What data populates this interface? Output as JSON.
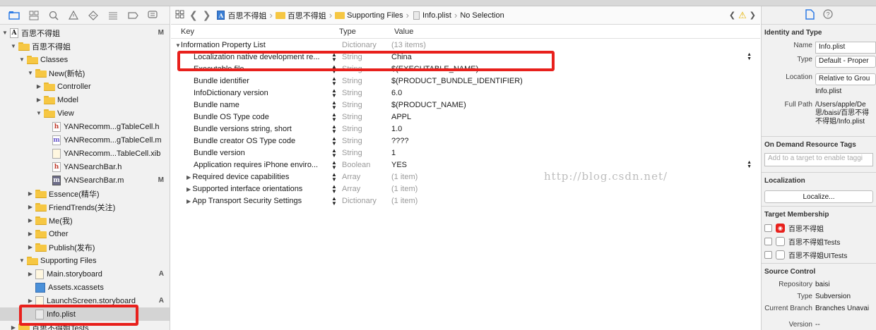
{
  "navigator": {
    "tree": [
      {
        "label": "百思不得姐",
        "kind": "project",
        "level": 0,
        "disclosure": "open",
        "badge": "M"
      },
      {
        "label": "百思不得姐",
        "kind": "folder",
        "level": 1,
        "disclosure": "open",
        "badge": ""
      },
      {
        "label": "Classes",
        "kind": "folder",
        "level": 2,
        "disclosure": "open",
        "badge": ""
      },
      {
        "label": "New(新帖)",
        "kind": "folder",
        "level": 3,
        "disclosure": "open",
        "badge": ""
      },
      {
        "label": "Controller",
        "kind": "folder",
        "level": 4,
        "disclosure": "closed",
        "badge": ""
      },
      {
        "label": "Model",
        "kind": "folder",
        "level": 4,
        "disclosure": "closed",
        "badge": ""
      },
      {
        "label": "View",
        "kind": "folder",
        "level": 4,
        "disclosure": "open",
        "badge": ""
      },
      {
        "label": "YANRecomm...gTableCell.h",
        "kind": "h",
        "level": 5,
        "disclosure": "none",
        "badge": ""
      },
      {
        "label": "YANRecomm...gTableCell.m",
        "kind": "m",
        "level": 5,
        "disclosure": "none",
        "badge": ""
      },
      {
        "label": "YANRecomm...TableCell.xib",
        "kind": "xib",
        "level": 5,
        "disclosure": "none",
        "badge": ""
      },
      {
        "label": "YANSearchBar.h",
        "kind": "h",
        "level": 5,
        "disclosure": "none",
        "badge": ""
      },
      {
        "label": "YANSearchBar.m",
        "kind": "mdark",
        "level": 5,
        "disclosure": "none",
        "badge": "M"
      },
      {
        "label": "Essence(精华)",
        "kind": "folder",
        "level": 3,
        "disclosure": "closed",
        "badge": ""
      },
      {
        "label": "FriendTrends(关注)",
        "kind": "folder",
        "level": 3,
        "disclosure": "closed",
        "badge": ""
      },
      {
        "label": "Me(我)",
        "kind": "folder",
        "level": 3,
        "disclosure": "closed",
        "badge": ""
      },
      {
        "label": "Other",
        "kind": "folder",
        "level": 3,
        "disclosure": "closed",
        "badge": ""
      },
      {
        "label": "Publish(发布)",
        "kind": "folder",
        "level": 3,
        "disclosure": "closed",
        "badge": ""
      },
      {
        "label": "Supporting Files",
        "kind": "folder",
        "level": 2,
        "disclosure": "open",
        "badge": ""
      },
      {
        "label": "Main.storyboard",
        "kind": "xib",
        "level": 3,
        "disclosure": "closed",
        "badge": "A"
      },
      {
        "label": "Assets.xcassets",
        "kind": "assets",
        "level": 3,
        "disclosure": "none",
        "badge": ""
      },
      {
        "label": "LaunchScreen.storyboard",
        "kind": "xib",
        "level": 3,
        "disclosure": "closed",
        "badge": "A"
      },
      {
        "label": "Info.plist",
        "kind": "plist",
        "level": 3,
        "disclosure": "none",
        "badge": "",
        "selected": true
      },
      {
        "label": "百思不得姐Tests",
        "kind": "folder",
        "level": 1,
        "disclosure": "closed",
        "badge": ""
      }
    ]
  },
  "jumpbar": {
    "crumbs": [
      "百思不得姐",
      "百思不得姐",
      "Supporting Files",
      "Info.plist",
      "No Selection"
    ]
  },
  "plist": {
    "headers": {
      "key": "Key",
      "type": "Type",
      "value": "Value"
    },
    "root": {
      "key": "Information Property List",
      "type": "Dictionary",
      "value": "(13 items)"
    },
    "rows": [
      {
        "key": "Localization native development re...",
        "type": "String",
        "value": "China",
        "dropdown": true
      },
      {
        "key": "Executable file",
        "type": "String",
        "value": "$(EXECUTABLE_NAME)"
      },
      {
        "key": "Bundle identifier",
        "type": "String",
        "value": "$(PRODUCT_BUNDLE_IDENTIFIER)"
      },
      {
        "key": "InfoDictionary version",
        "type": "String",
        "value": "6.0"
      },
      {
        "key": "Bundle name",
        "type": "String",
        "value": "$(PRODUCT_NAME)"
      },
      {
        "key": "Bundle OS Type code",
        "type": "String",
        "value": "APPL"
      },
      {
        "key": "Bundle versions string, short",
        "type": "String",
        "value": "1.0"
      },
      {
        "key": "Bundle creator OS Type code",
        "type": "String",
        "value": "????"
      },
      {
        "key": "Bundle version",
        "type": "String",
        "value": "1"
      },
      {
        "key": "Application requires iPhone enviro...",
        "type": "Boolean",
        "value": "YES",
        "dropdown": true
      },
      {
        "key": "Required device capabilities",
        "type": "Array",
        "value": "(1 item)",
        "collapsed": true
      },
      {
        "key": "Supported interface orientations",
        "type": "Array",
        "value": "(1 item)",
        "collapsed": true
      },
      {
        "key": "App Transport Security Settings",
        "type": "Dictionary",
        "value": "(1 item)",
        "collapsed": true
      }
    ],
    "watermark": "http://blog.csdn.net/"
  },
  "inspector": {
    "identity_title": "Identity and Type",
    "name_label": "Name",
    "name_value": "Info.plist",
    "type_label": "Type",
    "type_value": "Default - Proper",
    "location_label": "Location",
    "location_value": "Relative to Grou",
    "location_file": "Info.plist",
    "fullpath_label": "Full Path",
    "fullpath_value_1": "/Users/apple/De",
    "fullpath_value_2": "思/baisi/百思不得",
    "fullpath_value_3": "不得姐/Info.plist",
    "odr_title": "On Demand Resource Tags",
    "odr_placeholder": "Add to a target to enable taggi",
    "localization_title": "Localization",
    "localize_button": "Localize...",
    "membership_title": "Target Membership",
    "targets": [
      "百思不得姐",
      "百思不得姐Tests",
      "百思不得姐UITests"
    ],
    "source_title": "Source Control",
    "repo_label": "Repository",
    "repo_value": "baisi",
    "sc_type_label": "Type",
    "sc_type_value": "Subversion",
    "branch_label": "Current Branch",
    "branch_value": "Branches Unavai",
    "version_label": "Version",
    "version_value": "--"
  }
}
